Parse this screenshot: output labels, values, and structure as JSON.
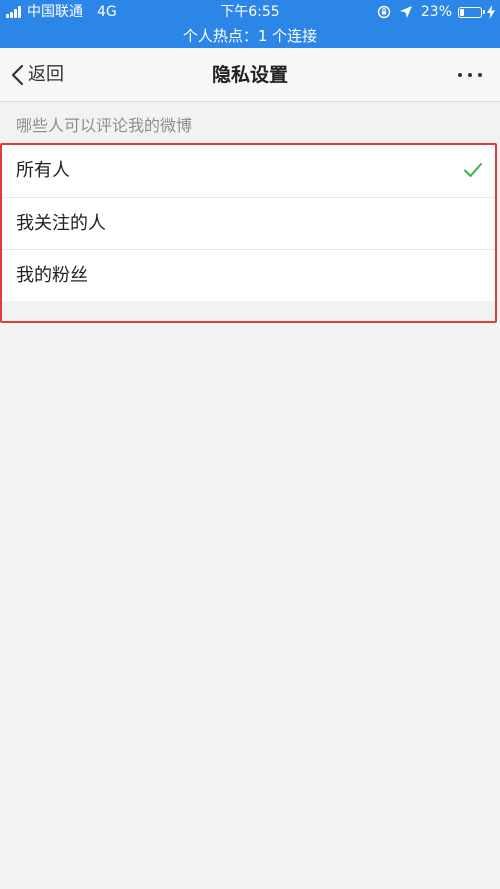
{
  "status_bar": {
    "carrier": "中国联通",
    "network": "4G",
    "time": "下午6:55",
    "battery": "23%",
    "hotspot": "个人热点：1 个连接",
    "icons": [
      "signal-icon",
      "lock-rotation-icon",
      "location-icon",
      "battery-icon",
      "charge-icon"
    ]
  },
  "nav": {
    "back_label": "返回",
    "title": "隐私设置",
    "more_icon": "more-icon"
  },
  "section": {
    "header": "哪些人可以评论我的微博"
  },
  "options": [
    {
      "label": "所有人",
      "selected": true
    },
    {
      "label": "我关注的人",
      "selected": false
    },
    {
      "label": "我的粉丝",
      "selected": false
    }
  ],
  "colors": {
    "status_bar_bg": "#2c86e8",
    "check": "#3bb34a",
    "highlight_border": "#e03c3c",
    "background": "#f2f2f2"
  }
}
